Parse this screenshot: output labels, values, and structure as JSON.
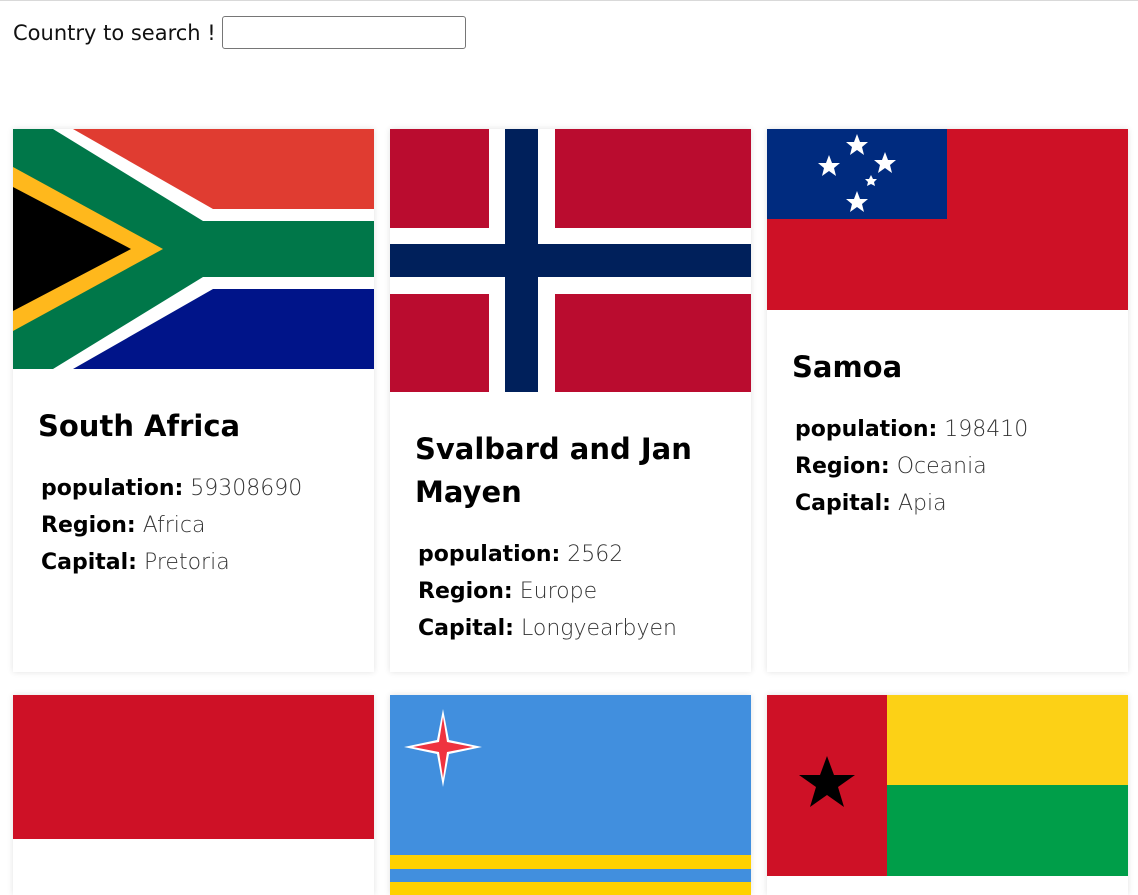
{
  "search": {
    "label": "Country to search !",
    "value": "",
    "placeholder": ""
  },
  "field_labels": {
    "population": "population:",
    "region": "Region:",
    "capital": "Capital:"
  },
  "countries": [
    {
      "name": "South Africa",
      "population": "59308690",
      "region": "Africa",
      "capital": "Pretoria",
      "flag_icon": "south-africa-flag-icon"
    },
    {
      "name": "Svalbard and Jan Mayen",
      "population": "2562",
      "region": "Europe",
      "capital": "Longyearbyen",
      "flag_icon": "svalbard-jan-mayen-flag-icon"
    },
    {
      "name": "Samoa",
      "population": "198410",
      "region": "Oceania",
      "capital": "Apia",
      "flag_icon": "samoa-flag-icon"
    },
    {
      "flag_icon": "indonesia-flag-icon"
    },
    {
      "flag_icon": "aruba-flag-icon"
    },
    {
      "flag_icon": "guinea-bissau-flag-icon"
    }
  ],
  "colors": {
    "shadow": "#e6e6e6",
    "input_border": "#767676"
  }
}
